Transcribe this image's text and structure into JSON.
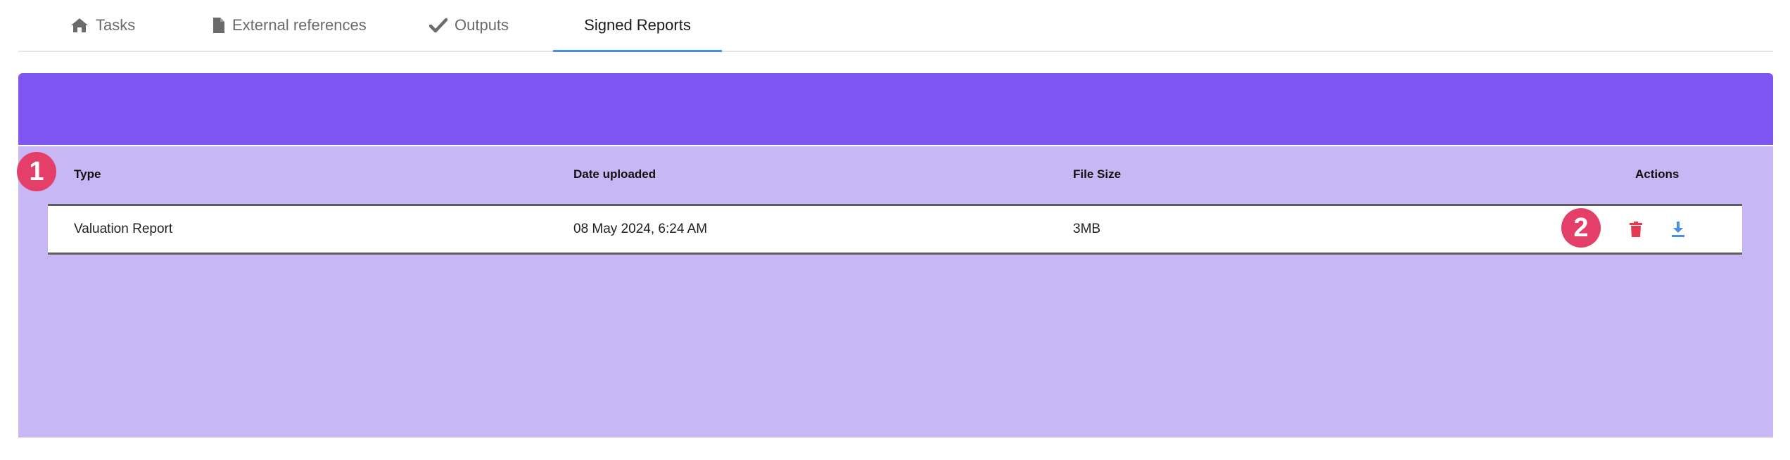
{
  "tabs": [
    {
      "label": "Tasks",
      "icon": "home-icon"
    },
    {
      "label": "External references",
      "icon": "document-icon"
    },
    {
      "label": "Outputs",
      "icon": "check-icon"
    },
    {
      "label": "Signed Reports",
      "icon": null,
      "active": true
    }
  ],
  "table": {
    "columns": {
      "type": "Type",
      "date": "Date uploaded",
      "size": "File Size",
      "actions": "Actions"
    },
    "rows": [
      {
        "type": "Valuation Report",
        "date": "08 May 2024, 6:24 AM",
        "size": "3MB"
      }
    ],
    "row_actions": [
      "delete-icon",
      "download-icon"
    ]
  },
  "badges": [
    "1",
    "2"
  ],
  "colors": {
    "header": "#7f56f2",
    "body": "#c9b6f4",
    "badge": "#e33f68",
    "delete": "#e53950",
    "download": "#4a90e2",
    "active_tab_underline": "#4a90e2"
  }
}
